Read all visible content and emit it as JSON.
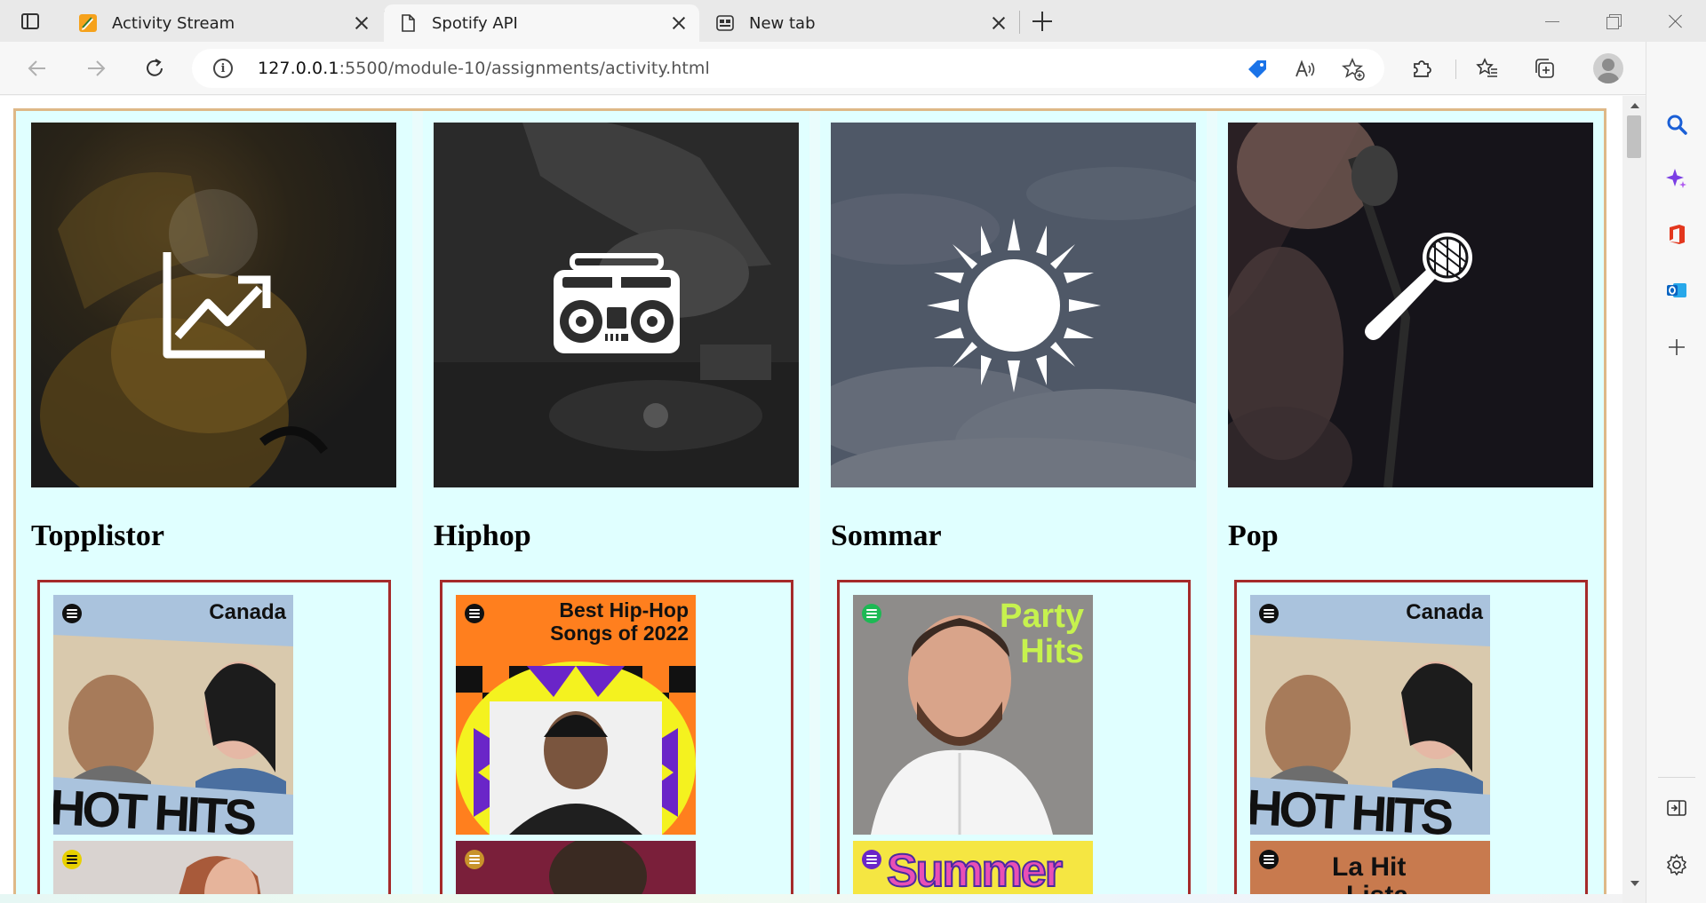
{
  "browser": {
    "tabs": [
      {
        "label": "Activity Stream",
        "active": false
      },
      {
        "label": "Spotify API",
        "active": true
      },
      {
        "label": "New tab",
        "active": false
      }
    ],
    "url_host": "127.0.0.1",
    "url_rest": ":5500/module-10/assignments/activity.html"
  },
  "colors": {
    "frame_border": "#deb887",
    "page_background": "#e0ffff",
    "playlist_border": "#a52a2a"
  },
  "categories": [
    {
      "title": "Topplistor",
      "icon": "chart-trend-icon",
      "covers": [
        {
          "label": "Canada",
          "big_text": "HOT HITS",
          "bg": "#aac3dd"
        },
        {
          "label": "",
          "big_text": "",
          "bg": "#d9d3d0"
        }
      ]
    },
    {
      "title": "Hiphop",
      "icon": "boombox-icon",
      "covers": [
        {
          "label": "Best Hip-Hop Songs of 2022",
          "line1": "Best Hip-Hop",
          "line2": "Songs of 2022",
          "bg": "#ff7f1e"
        },
        {
          "label": "",
          "big_text": "",
          "bg": "#b8324a"
        }
      ]
    },
    {
      "title": "Sommar",
      "icon": "sun-icon",
      "covers": [
        {
          "label": "Party Hits",
          "line1": "Party",
          "line2": "Hits",
          "bg": "#8f8f8f"
        },
        {
          "label": "Summer",
          "big_text": "Summer",
          "bg": "#f5e642"
        }
      ]
    },
    {
      "title": "Pop",
      "icon": "microphone-icon",
      "covers": [
        {
          "label": "Canada",
          "big_text": "HOT HITS",
          "bg": "#aac3dd"
        },
        {
          "label": "La Hit Lista",
          "line1": "La Hit",
          "line2": "Lista",
          "bg": "#c87a4e"
        }
      ]
    }
  ]
}
